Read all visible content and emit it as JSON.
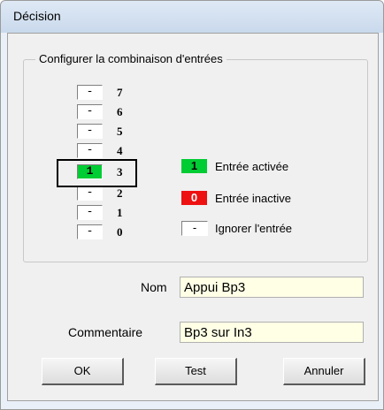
{
  "window": {
    "title": "Décision"
  },
  "group": {
    "title": "Configurer la combinaison d'entrées",
    "bits": [
      {
        "number": "7",
        "value": "-",
        "state": "ignore"
      },
      {
        "number": "6",
        "value": "-",
        "state": "ignore"
      },
      {
        "number": "5",
        "value": "-",
        "state": "ignore"
      },
      {
        "number": "4",
        "value": "-",
        "state": "ignore"
      },
      {
        "number": "3",
        "value": "1",
        "state": "active"
      },
      {
        "number": "2",
        "value": "-",
        "state": "ignore"
      },
      {
        "number": "1",
        "value": "-",
        "state": "ignore"
      },
      {
        "number": "0",
        "value": "-",
        "state": "ignore"
      }
    ],
    "selected_bit": "3",
    "legend": [
      {
        "symbol": "1",
        "label": "Entrée activée",
        "color": "#00cc33"
      },
      {
        "symbol": "0",
        "label": "Entrée inactive",
        "color": "#ee1111"
      },
      {
        "symbol": "-",
        "label": "Ignorer l'entrée",
        "color": "#ffffff"
      }
    ]
  },
  "form": {
    "name_label": "Nom",
    "name_value": "Appui Bp3",
    "comment_label": "Commentaire",
    "comment_value": "Bp3 sur In3"
  },
  "buttons": {
    "ok": "OK",
    "test": "Test",
    "cancel": "Annuler"
  }
}
